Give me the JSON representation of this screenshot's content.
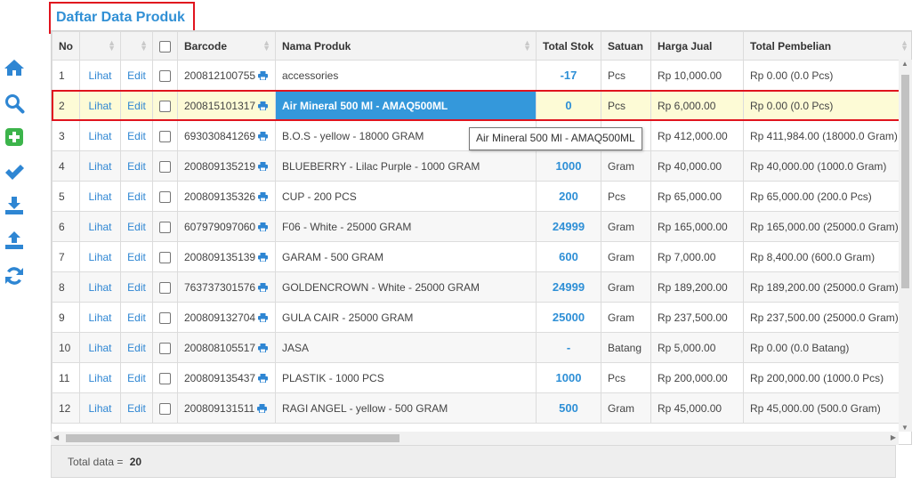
{
  "page": {
    "title": "Daftar Data Produk"
  },
  "sidebar": {
    "icons": [
      "home-icon",
      "search-icon",
      "add-icon",
      "check-icon",
      "download-icon",
      "upload-icon",
      "refresh-icon"
    ]
  },
  "table": {
    "headers": [
      "No",
      "",
      "",
      "",
      "Barcode",
      "Nama Produk",
      "Total Stok",
      "Satuan",
      "Harga Jual",
      "Total Pembelian"
    ],
    "view_label": "Lihat",
    "edit_label": "Edit",
    "rows": [
      {
        "no": "1",
        "barcode": "200812100755",
        "name": "accessories",
        "stock": "-17",
        "unit": "Pcs",
        "price": "Rp 10,000.00",
        "purchase": "Rp 0.00 (0.0 Pcs)"
      },
      {
        "no": "2",
        "barcode": "200815101317",
        "name": "Air Mineral 500 Ml - AMAQ500ML",
        "stock": "0",
        "unit": "Pcs",
        "price": "Rp 6,000.00",
        "purchase": "Rp 0.00 (0.0 Pcs)"
      },
      {
        "no": "3",
        "barcode": "693030841269",
        "name": "B.O.S - yellow - 18000 GRAM",
        "stock": "",
        "unit": "",
        "price": "Rp 412,000.00",
        "purchase": "Rp 411,984.00 (18000.0 Gram)"
      },
      {
        "no": "4",
        "barcode": "200809135219",
        "name": "BLUEBERRY - Lilac Purple - 1000 GRAM",
        "stock": "1000",
        "unit": "Gram",
        "price": "Rp 40,000.00",
        "purchase": "Rp 40,000.00 (1000.0 Gram)"
      },
      {
        "no": "5",
        "barcode": "200809135326",
        "name": "CUP - 200 PCS",
        "stock": "200",
        "unit": "Pcs",
        "price": "Rp 65,000.00",
        "purchase": "Rp 65,000.00 (200.0 Pcs)"
      },
      {
        "no": "6",
        "barcode": "607979097060",
        "name": "F06 - White - 25000 GRAM",
        "stock": "24999",
        "unit": "Gram",
        "price": "Rp 165,000.00",
        "purchase": "Rp 165,000.00 (25000.0 Gram)"
      },
      {
        "no": "7",
        "barcode": "200809135139",
        "name": "GARAM - 500 GRAM",
        "stock": "600",
        "unit": "Gram",
        "price": "Rp 7,000.00",
        "purchase": "Rp 8,400.00 (600.0 Gram)"
      },
      {
        "no": "8",
        "barcode": "763737301576",
        "name": "GOLDENCROWN - White - 25000 GRAM",
        "stock": "24999",
        "unit": "Gram",
        "price": "Rp 189,200.00",
        "purchase": "Rp 189,200.00 (25000.0 Gram)"
      },
      {
        "no": "9",
        "barcode": "200809132704",
        "name": "GULA CAIR - 25000 GRAM",
        "stock": "25000",
        "unit": "Gram",
        "price": "Rp 237,500.00",
        "purchase": "Rp 237,500.00 (25000.0 Gram)"
      },
      {
        "no": "10",
        "barcode": "200808105517",
        "name": "JASA",
        "stock": "-",
        "unit": "Batang",
        "price": "Rp 5,000.00",
        "purchase": "Rp 0.00 (0.0 Batang)"
      },
      {
        "no": "11",
        "barcode": "200809135437",
        "name": "PLASTIK - 1000 PCS",
        "stock": "1000",
        "unit": "Pcs",
        "price": "Rp 200,000.00",
        "purchase": "Rp 200,000.00 (1000.0 Pcs)"
      },
      {
        "no": "12",
        "barcode": "200809131511",
        "name": "RAGI ANGEL - yellow - 500 GRAM",
        "stock": "500",
        "unit": "Gram",
        "price": "Rp 45,000.00",
        "purchase": "Rp 45,000.00 (500.0 Gram)"
      }
    ]
  },
  "tooltip": {
    "text": "Air Mineral 500 Ml - AMAQ500ML"
  },
  "footer": {
    "label": "Total data =",
    "count": "20"
  },
  "colors": {
    "accent": "#3190d5",
    "highlight": "#3498db",
    "selection_border": "#e0141e",
    "stock_text": "#2e8fd6"
  }
}
